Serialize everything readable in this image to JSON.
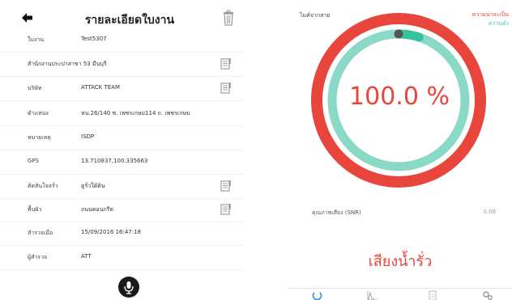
{
  "left": {
    "title": "รายละเอียดใบงาน",
    "rows": [
      {
        "label": "ใบงาน",
        "value": "Test5307"
      },
      {
        "label": "",
        "value": "สำนักงานประปาสาขา 53 มีนบุรี"
      },
      {
        "label": "บริษัท",
        "value": "ATTACK TEAM"
      },
      {
        "label": "ตำแหน่ง",
        "value": "หน.26/140 ซ. เพชรเกษม114 ถ. เพชรเกษม"
      },
      {
        "label": "หมายเหตุ",
        "value": "ISDP"
      },
      {
        "label": "GPS",
        "value": "13.710837,100.335663"
      },
      {
        "label": "ตัดสินใจลรั่ว",
        "value": "ดูรั่วใต้ดิน"
      },
      {
        "label": "พื้นผิว",
        "value": "ถนนคอนกรีต"
      },
      {
        "label": "สำรวจเมื่อ",
        "value": "15/09/2016 16:47:18"
      },
      {
        "label": "ผู้สำรวจ",
        "value": "ATT"
      }
    ]
  },
  "right": {
    "mode_label": "ไมค์จากสาย",
    "legend_red": "ความน่าจะเป็น",
    "legend_teal": "ความดัง",
    "percent_text": "100.0 %",
    "probability_percent": 100,
    "loudness_fraction": 0.05,
    "snr_label": "คุณภาพเสียง (SNR)",
    "snr_value": "0.00",
    "result": "เสียงน้ำรั่ว",
    "colors": {
      "red": "#e8453c",
      "teal": "#8ad9c7",
      "teal_dark": "#34c39a"
    }
  }
}
